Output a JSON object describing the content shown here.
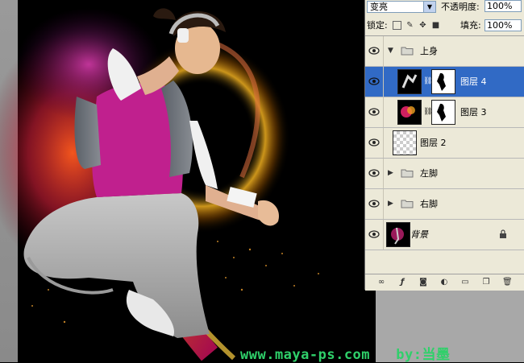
{
  "layers_panel": {
    "blend_mode": "变亮",
    "opacity_label": "不透明度:",
    "opacity_value": "100%",
    "lock_label": "锁定:",
    "fill_label": "填充:",
    "fill_value": "100%",
    "layers": [
      {
        "name": "上身",
        "kind": "group",
        "expanded": true,
        "visible": true
      },
      {
        "name": "图层 4",
        "kind": "layer-with-mask",
        "selected": true,
        "visible": true
      },
      {
        "name": "图层 3",
        "kind": "layer-with-mask",
        "visible": true
      },
      {
        "name": "图层 2",
        "kind": "layer",
        "visible": true
      },
      {
        "name": "左脚",
        "kind": "group",
        "expanded": false,
        "visible": true
      },
      {
        "name": "右脚",
        "kind": "group",
        "expanded": false,
        "visible": true
      },
      {
        "name": "背景",
        "kind": "background",
        "locked": true,
        "visible": true
      }
    ],
    "bottom_icons": [
      "link-icon",
      "layer-style-icon",
      "add-mask-icon",
      "adjustment-layer-icon",
      "new-group-icon",
      "new-layer-icon",
      "delete-layer-icon"
    ]
  },
  "watermark": {
    "site": "www.maya-ps.com",
    "author": "by:当墨"
  },
  "colors": {
    "panel_bg": "#ece9d8",
    "selection": "#316ac5",
    "watermark": "#2fd06a"
  }
}
